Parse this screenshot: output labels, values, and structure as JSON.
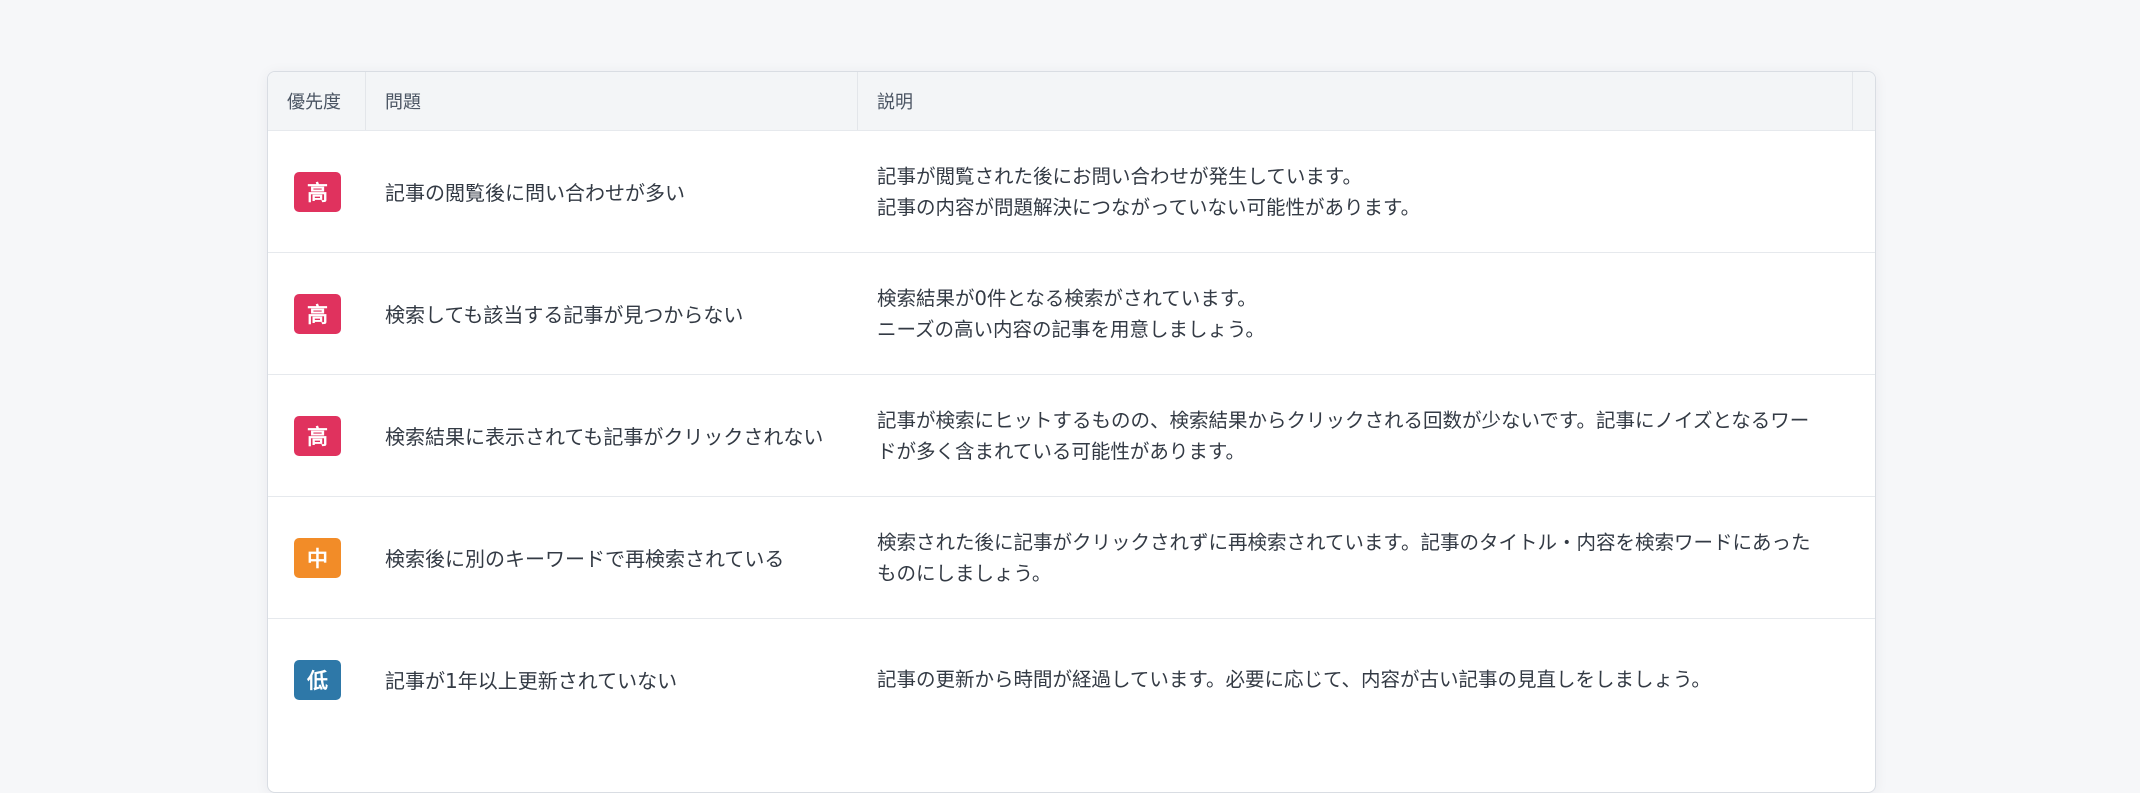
{
  "table": {
    "headers": {
      "priority": "優先度",
      "issue": "問題",
      "description": "説明"
    },
    "rows": [
      {
        "priority": "高",
        "level": "high",
        "issue": "記事の閲覧後に問い合わせが多い",
        "description": [
          "記事が閲覧された後にお問い合わせが発生しています。",
          "記事の内容が問題解決につながっていない可能性があります。"
        ]
      },
      {
        "priority": "高",
        "level": "high",
        "issue": "検索しても該当する記事が見つからない",
        "description": [
          "検索結果が0件となる検索がされています。",
          "ニーズの高い内容の記事を用意しましょう。"
        ]
      },
      {
        "priority": "高",
        "level": "high",
        "issue": "検索結果に表示されても記事がクリックされない",
        "description": [
          "記事が検索にヒットするものの、検索結果からクリックされる回数が少ないです。記事にノイズとなるワー",
          "ドが多く含まれている可能性があります。"
        ]
      },
      {
        "priority": "中",
        "level": "mid",
        "issue": "検索後に別のキーワードで再検索されている",
        "description": [
          "検索された後に記事がクリックされずに再検索されています。記事のタイトル・内容を検索ワードにあった",
          "ものにしましょう。"
        ]
      },
      {
        "priority": "低",
        "level": "low",
        "issue": "記事が1年以上更新されていない",
        "description": [
          "記事の更新から時間が経過しています。必要に応じて、内容が古い記事の見直しをしましょう。"
        ]
      }
    ]
  },
  "colors": {
    "high": "#e0325e",
    "mid": "#f28c28",
    "low": "#2e78a8"
  }
}
